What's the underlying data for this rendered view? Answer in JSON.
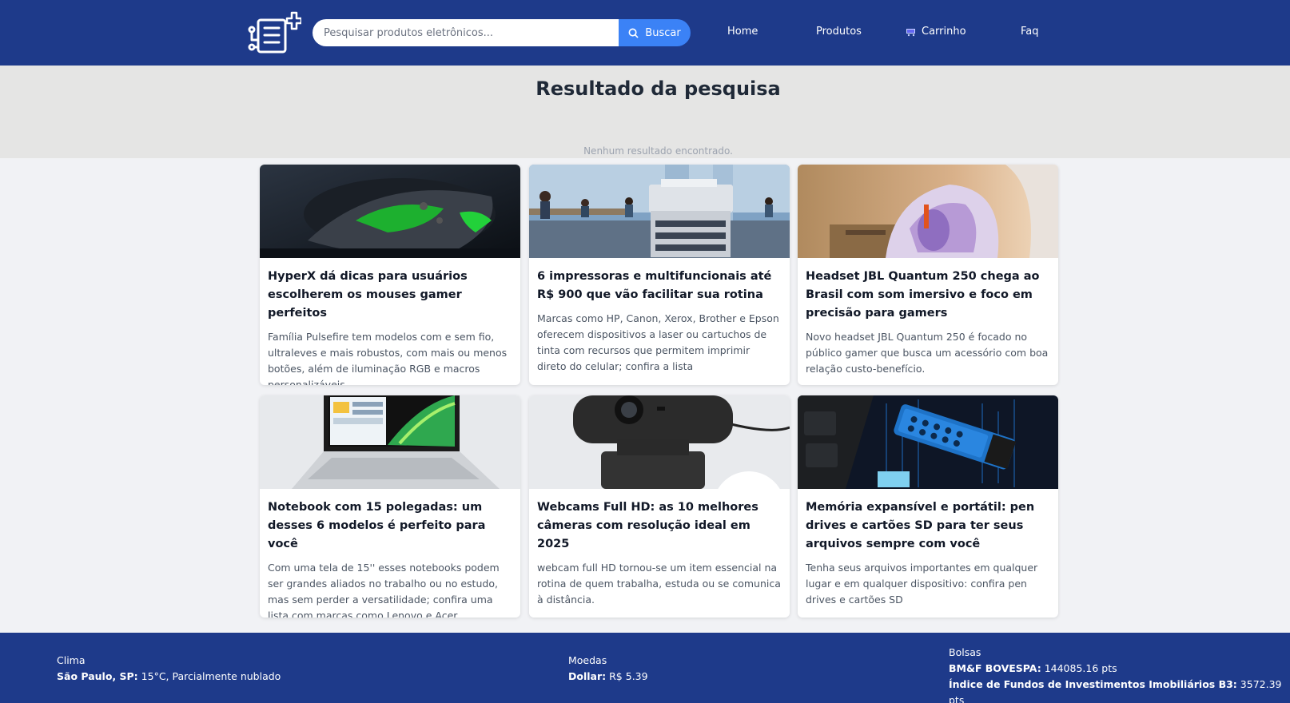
{
  "header": {
    "search_placeholder": "Pesquisar produtos eletrônicos...",
    "search_button": "Buscar",
    "nav": [
      "Home",
      "Produtos",
      "Carrinho",
      "Faq"
    ],
    "cart_icon": "cart-icon"
  },
  "results": {
    "title": "Resultado da pesquisa",
    "empty_message": "Nenhum resultado encontrado."
  },
  "articles": [
    {
      "title": "HyperX dá dicas para usuários escolherem os mouses gamer perfeitos",
      "summary": "Família Pulsefire tem modelos com e sem fio, ultraleves e mais robustos, com mais ou menos botões, além de iluminação RGB e macros personalizáveis",
      "image": "gaming-mouse-image"
    },
    {
      "title": "6 impressoras e multifuncionais até R$ 900 que vão facilitar sua rotina",
      "summary": "Marcas como HP, Canon, Xerox, Brother e Epson oferecem dispositivos a laser ou cartuchos de tinta com recursos que permitem imprimir direto do celular; confira a lista",
      "image": "office-printer-image"
    },
    {
      "title": "Headset JBL Quantum 250 chega ao Brasil com som imersivo e foco em precisão para gamers",
      "summary": "Novo headset JBL Quantum 250 é focado no público gamer que busca um acessório com boa relação custo-benefício.",
      "image": "headset-image"
    },
    {
      "title": "Notebook com 15 polegadas: um desses 6 modelos é perfeito para você",
      "summary": "Com uma tela de 15'' esses notebooks podem ser grandes aliados no trabalho ou no estudo, mas sem perder a versatilidade; confira uma lista com marcas como Lenovo e Acer",
      "image": "notebook-image"
    },
    {
      "title": "Webcams Full HD: as 10 melhores câmeras com resolução ideal em 2025",
      "summary": "webcam full HD tornou-se um item essencial na rotina de quem trabalha, estuda ou se comunica à distância.",
      "image": "webcam-image"
    },
    {
      "title": "Memória expansível e portátil: pen drives e cartões SD para ter seus arquivos sempre com você",
      "summary": "Tenha seus arquivos importantes em qualquer lugar e em qualquer dispositivo: confira pen drives e cartões SD",
      "image": "pen-drive-image"
    }
  ],
  "footer": {
    "weather": {
      "heading": "Clima",
      "location": "São Paulo, SP:",
      "value": "15°C, Parcialmente nublado"
    },
    "currency": {
      "heading": "Moedas",
      "label": "Dollar:",
      "value": "R$ 5.39"
    },
    "stocks": {
      "heading": "Bolsas",
      "items": [
        {
          "label": "BM&F BOVESPA:",
          "value": "144085.16 pts"
        },
        {
          "label": "Índice de Fundos de Investimentos Imobiliários B3:",
          "value": "3572.39 pts"
        }
      ]
    }
  },
  "colors": {
    "header_bg": "#1e3a8a",
    "accent": "#3b82f6",
    "band_bg": "#e5e5e4",
    "page_bg": "#f1f2f5"
  }
}
